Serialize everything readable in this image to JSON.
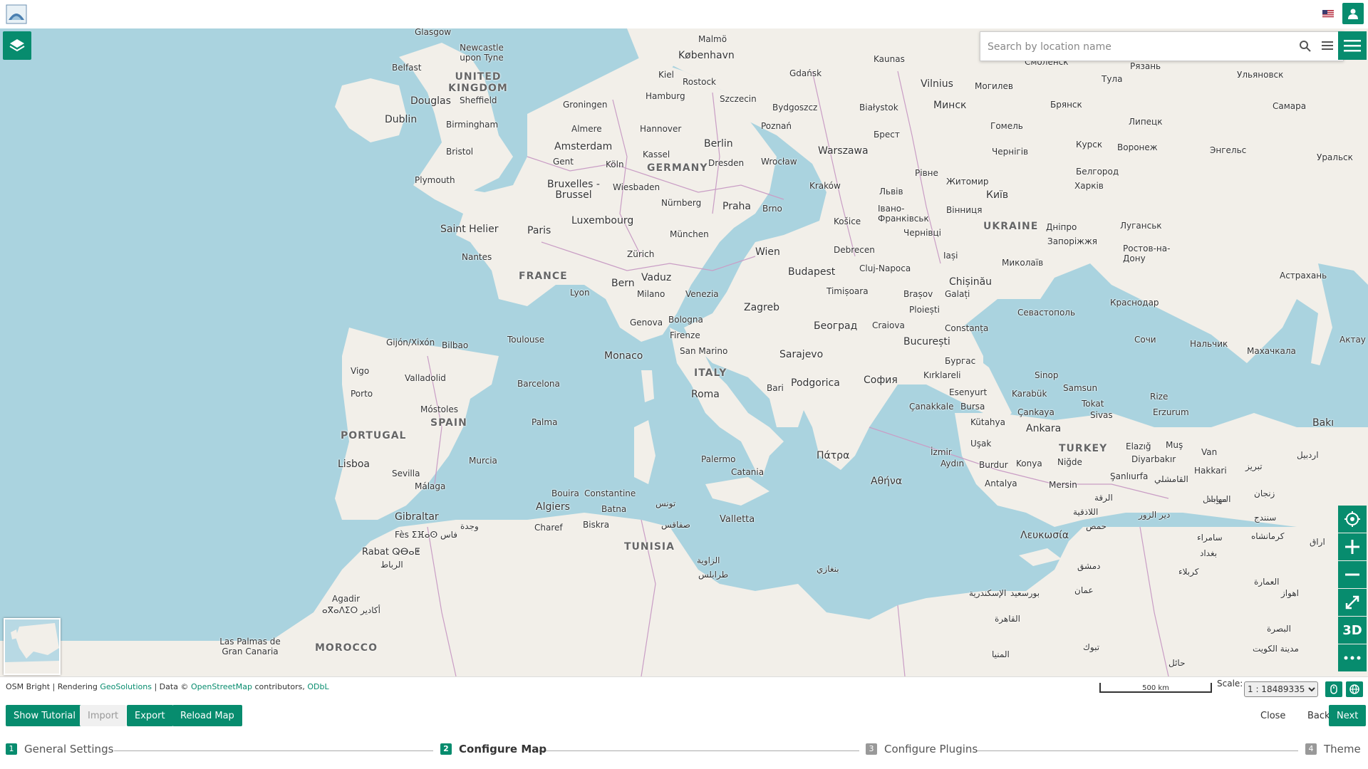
{
  "header": {
    "logo_icon": "mapstore-logo-icon",
    "flag_icon": "us-flag-icon",
    "user_icon": "user-icon"
  },
  "search": {
    "placeholder": "Search by location name",
    "value": ""
  },
  "map": {
    "labels": {
      "glasgow": "Glasgow",
      "newcastle": "Newcastle upon Tyne",
      "belfast": "Belfast",
      "uk": "UNITED KINGDOM",
      "douglas": "Douglas",
      "sheffield": "Sheffield",
      "dublin": "Dublin",
      "birmingham": "Birmingham",
      "bristol": "Bristol",
      "plymouth": "Plymouth",
      "malmo": "Malmö",
      "kobenhavn": "København",
      "kiel": "Kiel",
      "rostock": "Rostock",
      "hamburg": "Hamburg",
      "szczecin": "Szczecin",
      "gdansk": "Gdańsk",
      "kaunas": "Kaunas",
      "vilnius": "Vilnius",
      "smolensk": "Смоленск",
      "ryazan": "Рязань",
      "tula": "Тула",
      "ulyanovsk": "Ульяновск",
      "mogilev": "Могилев",
      "minsk": "Минск",
      "bryansk": "Брянск",
      "samara": "Самара",
      "groningen": "Groningen",
      "bydgoszcz": "Bydgoszcz",
      "bialystok": "Białystok",
      "almere": "Almere",
      "hannover": "Hannover",
      "poznan": "Poznań",
      "amsterdam": "Amsterdam",
      "berlin": "Berlin",
      "gomel": "Гомель",
      "lipetsk": "Липецк",
      "brest": "Брест",
      "kassel": "Kassel",
      "gent": "Gent",
      "koln": "Köln",
      "germany": "GERMANY",
      "dresden": "Dresden",
      "wroclaw": "Wrocław",
      "warszawa": "Warszawa",
      "chernihiv": "Чернігів",
      "kursk": "Курск",
      "voronezh": "Воронеж",
      "engels": "Энгельс",
      "uralsk": "Уральск",
      "bruxelles": "Bruxelles - Brussel",
      "wiesbaden": "Wiesbaden",
      "belgorod": "Белгород",
      "rivne": "Рівне",
      "zhytomyr": "Житомир",
      "krakow": "Kraków",
      "kharkiv": "Харків",
      "lviv": "Львів",
      "kyiv": "Київ",
      "nurnberg": "Nürnberg",
      "praha": "Praha",
      "brno": "Brno",
      "luxembourg": "Luxembourg",
      "ivano": "Івано-Франківськ",
      "vinnytsia": "Вінниця",
      "saint_helier": "Saint Helier",
      "paris": "Paris",
      "kosice": "Košice",
      "luhansk": "Луганськ",
      "munchen": "München",
      "chernivtsi": "Чернівці",
      "ukraine": "UKRAINE",
      "dnipro": "Дніпро",
      "zaporizhzhia": "Запоріжжя",
      "rostov": "Ростов-на-Дону",
      "zurich": "Zürich",
      "wien": "Wien",
      "debrecen": "Debrecen",
      "nantes": "Nantes",
      "iasi": "Iași",
      "mykolaiv": "Миколаїв",
      "vaduz": "Vaduz",
      "cluj": "Cluj-Napoca",
      "france": "FRANCE",
      "bern": "Bern",
      "budapest": "Budapest",
      "chisinau": "Chișinău",
      "astrakhan": "Астрахань",
      "lyon": "Lyon",
      "milano": "Milano",
      "venezia": "Venezia",
      "timisoara": "Timișoara",
      "galati": "Galați",
      "brasov": "Brașov",
      "krasnodar": "Краснодар",
      "zagreb": "Zagreb",
      "genova": "Genova",
      "bologna": "Bologna",
      "ploiesti": "Ploiești",
      "sevastopol": "Севастополь",
      "beograd": "Београд",
      "craiova": "Craiova",
      "constanta": "Constanța",
      "gijon": "Gijón/Xixón",
      "bilbao": "Bilbao",
      "toulouse": "Toulouse",
      "firenze": "Firenze",
      "bucuresti": "București",
      "sochi": "Сочи",
      "nalchik": "Нальчик",
      "aktau": "Актау",
      "monaco": "Monaco",
      "san_marino": "San Marino",
      "sarajevo": "Sarajevo",
      "burgas": "Бургас",
      "makhachkala": "Махачкала",
      "vigo": "Vigo",
      "italy": "ITALY",
      "kirklareli": "Kırklareli",
      "sinop": "Sinop",
      "valladolid": "Valladolid",
      "barcelona": "Barcelona",
      "podgorica": "Podgorica",
      "sofia": "София",
      "samsun": "Samsun",
      "porto": "Porto",
      "roma": "Roma",
      "bari": "Bari",
      "esenyurt": "Esenyurt",
      "karabuk": "Karabük",
      "rize": "Rize",
      "tokat": "Tokat",
      "mostoles": "Móstoles",
      "canakkale": "Çanakkale",
      "bursa": "Bursa",
      "cankaya": "Çankaya",
      "sivas": "Sivas",
      "erzurum": "Erzurum",
      "spain": "SPAIN",
      "palma": "Palma",
      "baki": "Bakı",
      "portugal": "PORTUGAL",
      "kutahya": "Kütahya",
      "ankara": "Ankara",
      "turkey": "TURKEY",
      "usak": "Uşak",
      "elazig": "Elazığ",
      "mus": "Muş",
      "izmir": "İzmir",
      "van": "Van",
      "murcia": "Murcia",
      "palermo": "Palermo",
      "patra": "Πάτρα",
      "aydin": "Aydın",
      "burdur": "Burdur",
      "konya": "Konya",
      "nigde": "Niğde",
      "diyarbakir": "Diyarbakır",
      "hakkari": "Hakkari",
      "lisboa": "Lisboa",
      "catania": "Catania",
      "sevilla": "Sevilla",
      "sanliurfa": "Şanlıurfa",
      "athina": "Αθήνα",
      "antalya": "Antalya",
      "mersin": "Mersin",
      "malaga": "Málaga",
      "bouira": "Bouira",
      "constantine": "Constantine",
      "tunis": "تونس",
      "algiers": "Algiers",
      "batna": "Batna",
      "gibraltar": "Gibraltar",
      "valletta": "Valletta",
      "biskra": "Biskra",
      "sfax": "صفاقس",
      "charef": "Charef",
      "oujda": "وجدة",
      "lefkosia": "Λευκωσία",
      "homs": "حمص",
      "fes": "Fès ⵉⴼⴰⵙ فاس",
      "tunisia": "TUNISIA",
      "rabat": "Rabat ⵕⴱⴰⵟ",
      "rabat_ar": "الرباط",
      "damascus": "دمشق",
      "tripoli": "طرابلس",
      "zawiya": "الزاوية",
      "benghazi": "بنغازي",
      "amman": "عمان",
      "agadir": "Agadir",
      "agadir_ar": "ⴰⴳⴰⴷⵉⵔ أكادير",
      "alexandria": "الإسكندرية",
      "portsaid": "بورسعيد",
      "cairo": "القاهرة",
      "laspalmas": "Las Palmas de Gran Canaria",
      "morocco": "MOROCCO",
      "minya": "المنيا",
      "tabuk": "تبوك",
      "kuwait": "مدينة الكويت",
      "hail": "حائل",
      "raqqa": "الرقة",
      "deirezzor": "دير الزور",
      "mosul": "الموصل",
      "baghdad": "بغداد",
      "karbala": "كربلاء",
      "samarra": "سامراء",
      "sanandaj": "سنندج",
      "kermanshah": "كرمانشاه",
      "iraq": "اراق",
      "amara": "العمارة",
      "ahvaz": "اهواز",
      "basra": "البصرة",
      "tabriz": "تبريز",
      "ardabil": "اردبيل",
      "zanjan": "زنجان",
      "mahabad": "مهاباد",
      "qamishli": "القامشلي",
      "latakia": "اللاذقية"
    }
  },
  "map_controls": {
    "layers_icon": "layers-icon",
    "burger_icon": "menu-icon",
    "side_buttons": [
      {
        "icon": "locate-icon"
      },
      {
        "icon": "zoom-in-icon"
      },
      {
        "icon": "zoom-out-icon"
      },
      {
        "icon": "fullscreen-icon"
      },
      {
        "label": "3D"
      },
      {
        "icon": "more-icon"
      }
    ]
  },
  "footer": {
    "attribution_prefix": "OSM Bright | Rendering ",
    "attribution_geosolutions": "GeoSolutions",
    "attribution_mid": " | Data © ",
    "attribution_osm": "OpenStreetMap",
    "attribution_contrib": " contributors, ",
    "attribution_odbl": "ODbL",
    "scalebar_label": "500 km",
    "scale_label": "Scale:",
    "scale_value": "1 : 18489335"
  },
  "toolbar": {
    "show_tutorial": "Show Tutorial",
    "import": "Import",
    "export": "Export",
    "reload_map": "Reload Map",
    "close": "Close",
    "back": "Back",
    "next": "Next"
  },
  "steps": [
    {
      "num": "1",
      "label": "General Settings"
    },
    {
      "num": "2",
      "label": "Configure Map"
    },
    {
      "num": "3",
      "label": "Configure Plugins"
    },
    {
      "num": "4",
      "label": "Theme"
    }
  ]
}
